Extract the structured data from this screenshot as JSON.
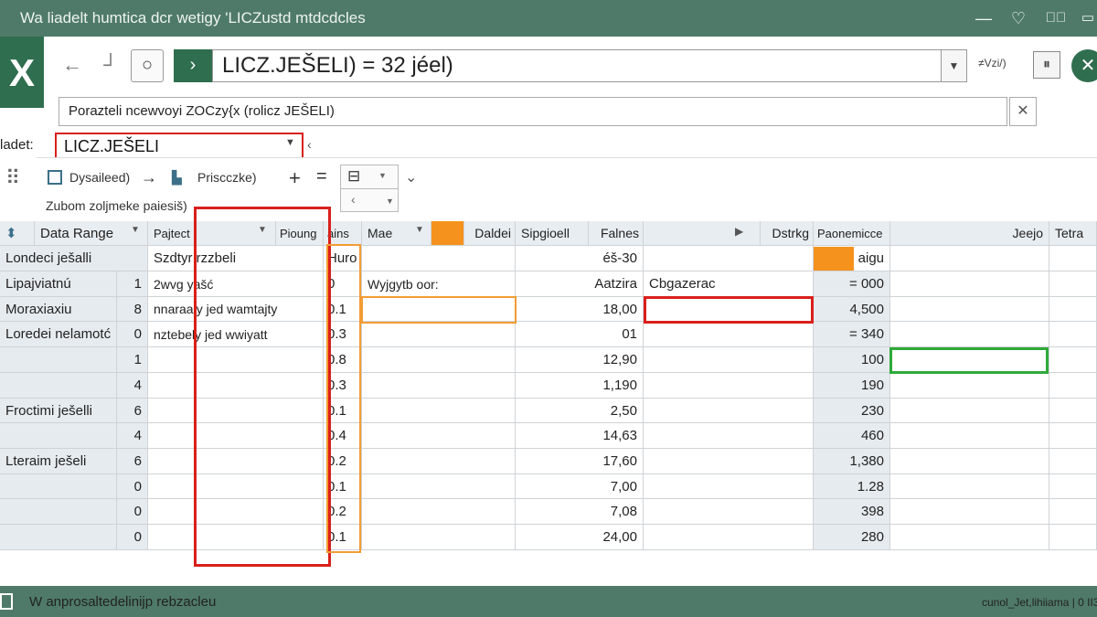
{
  "window": {
    "title": "Wa liadelt humtica dcr wetigy 'LICZustd mtdcdcles",
    "controls": [
      "—",
      "♡",
      "▯⃝",
      "▭"
    ]
  },
  "toolbar": {
    "logo": "X",
    "back_icon": "←",
    "fwd_icon": "┘",
    "circle_icon": "○",
    "go_icon": "›",
    "formula": "LICZ.JEŠELI) = 32 jéel)",
    "formula_dropdown": "▼",
    "small_label": "≠Vzi/)",
    "pause_icon": "⏸",
    "close_icon": "✕"
  },
  "description": {
    "text": "Porazteli ncewvoyi ZOCzy{x (rolicz JEŠELI)",
    "close_icon": "✕"
  },
  "name_row": {
    "label": "ladet:",
    "selected": "LICZ.JEŠELI",
    "dropdown": "▼",
    "back": "‹"
  },
  "ribbon": {
    "side_icon": "⠿",
    "item1_label": "Dysaileed)",
    "arrow_icon": "→",
    "item2_label": "Priscczke)",
    "plus_icon": "+",
    "eq_icon": "=",
    "group_icon": "⊟",
    "group_dd": "▼",
    "group_left": "‹",
    "group_right_dd": "▼",
    "chevron_icon": "⌄",
    "subtitle": "Zubom zoljmeke paiesiš)"
  },
  "grid": {
    "headers": [
      "Data Range",
      "Pajtect",
      "Pioung",
      "ains",
      "Mae",
      "",
      "Daldei",
      "Sipgioell",
      "Falnes",
      "",
      "Dstrkg",
      "Paonemicce",
      "Jeejo",
      "Tetra"
    ],
    "header_icons": {
      "h0_arrow": "⬍",
      "data_range_dd": "▼",
      "pajtect_dd": "▼",
      "mae_dd": "▼",
      "arrow_right": "▶"
    },
    "subheader": [
      "Londeci ješalli",
      "Szdtyr rzzbeli",
      "Huro",
      "",
      "",
      "",
      "éš-30",
      "",
      "aigu"
    ],
    "rows": [
      {
        "label": "Lipajviatnú",
        "n": "1",
        "col3": "2wvg yašć",
        "col4": "0",
        "col5": "Wyjgytb oor:",
        "col6": "Aatzira",
        "col7": "Cbgazerac",
        "col8": "= 000"
      },
      {
        "label": "Moraxiaxiu",
        "n": "8",
        "col3": "nnaraaly jed wamtajty",
        "col4": "0.1",
        "col5": "",
        "col6": "18,00",
        "col7": "",
        "col8": "4,500"
      },
      {
        "label": "Loredei nelamotć",
        "n": "0",
        "col3": "nztebely jed wwiyatt",
        "col4": "0.3",
        "col5": "",
        "col6": "01",
        "col7": "",
        "col8": "= 340"
      },
      {
        "label": "",
        "n": "1",
        "col3": "",
        "col4": "0.8",
        "col5": "",
        "col6": "12,90",
        "col7": "",
        "col8": "100"
      },
      {
        "label": "",
        "n": "4",
        "col3": "",
        "col4": "0.3",
        "col5": "",
        "col6": "1,190",
        "col7": "",
        "col8": "190"
      },
      {
        "label": "Froctimi ješelli",
        "n": "6",
        "col3": "",
        "col4": "0.1",
        "col5": "",
        "col6": "2,50",
        "col7": "",
        "col8": "230"
      },
      {
        "label": "",
        "n": "4",
        "col3": "",
        "col4": "0.4",
        "col5": "",
        "col6": "14,63",
        "col7": "",
        "col8": "460"
      },
      {
        "label": "Lteraim ješeli",
        "n": "6",
        "col3": "",
        "col4": "0.2",
        "col5": "",
        "col6": "17,60",
        "col7": "",
        "col8": "1,380"
      },
      {
        "label": "",
        "n": "0",
        "col3": "",
        "col4": "0.1",
        "col5": "",
        "col6": "7,00",
        "col7": "",
        "col8": "1.28"
      },
      {
        "label": "",
        "n": "0",
        "col3": "",
        "col4": "0.2",
        "col5": "",
        "col6": "7,08",
        "col7": "",
        "col8": "398"
      },
      {
        "label": "",
        "n": "0",
        "col3": "",
        "col4": "0.1",
        "col5": "",
        "col6": "24,00",
        "col7": "",
        "col8": "280"
      }
    ]
  },
  "colors": {
    "title_bar": "#4f7a69",
    "accent_green": "#2f6e4e",
    "highlight_red": "#d9201b",
    "highlight_orange": "#f39c33",
    "highlight_green": "#2fa93a"
  },
  "status": {
    "left": "W anprosaltedelinijp rebzacleu",
    "right": "cunol_Jet,lihiiama | 0 II3"
  }
}
